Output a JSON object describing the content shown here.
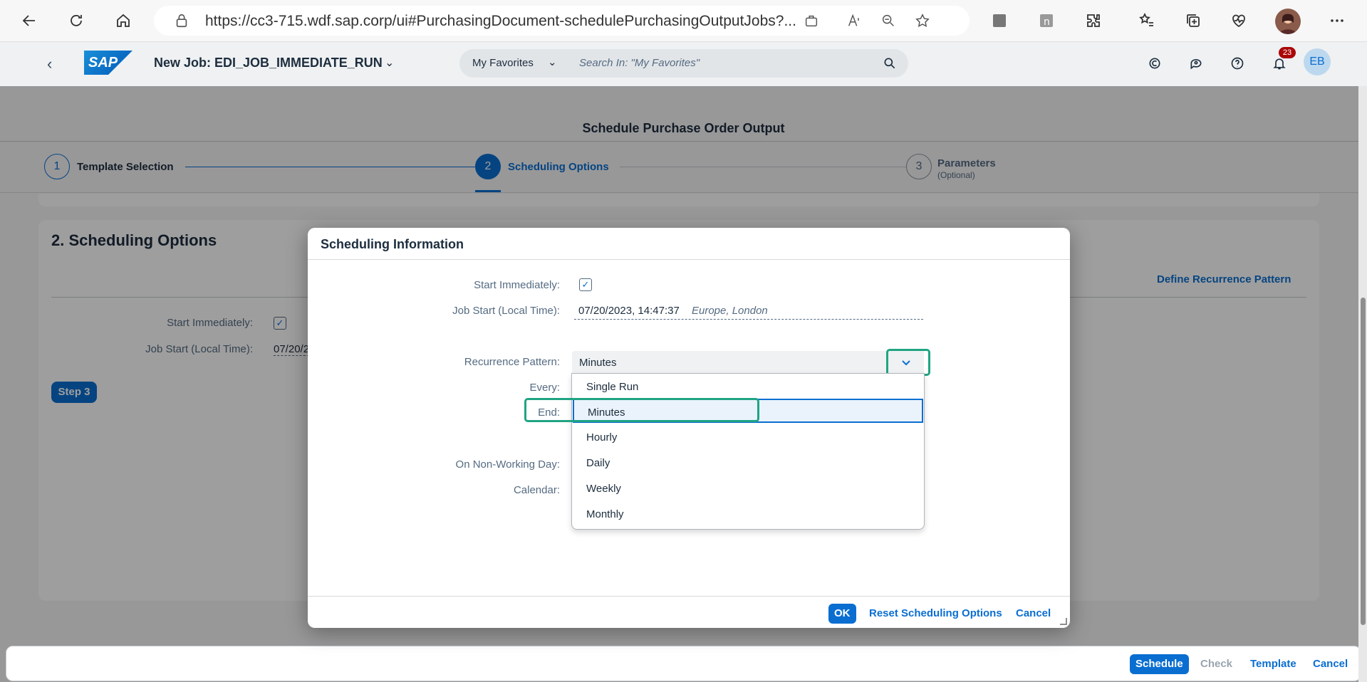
{
  "browser": {
    "url": "https://cc3-715.wdf.sap.corp/ui#PurchasingDocument-schedulePurchasingOutputJobs?..."
  },
  "shell": {
    "title": "New Job: EDI_JOB_IMMEDIATE_RUN",
    "search_scope": "My Favorites",
    "search_placeholder": "Search In: \"My Favorites\"",
    "notification_count": "23",
    "user_initials": "EB",
    "logo": "SAP"
  },
  "page": {
    "title": "Schedule Purchase Order Output",
    "steps": [
      {
        "number": "1",
        "label": "Template Selection"
      },
      {
        "number": "2",
        "label": "Scheduling Options"
      },
      {
        "number": "3",
        "label": "Parameters",
        "sublabel": "(Optional)"
      }
    ]
  },
  "background": {
    "section_title": "2. Scheduling Options",
    "define_recurrence_link": "Define Recurrence Pattern",
    "start_immediately_label": "Start Immediately:",
    "job_start_label": "Job Start (Local Time):",
    "job_start_value": "07/20/2",
    "step3_button": "Step 3"
  },
  "dialog": {
    "title": "Scheduling Information",
    "start_immediately_label": "Start Immediately:",
    "start_immediately_checked": true,
    "job_start_label": "Job Start (Local Time):",
    "job_start_value": "07/20/2023, 14:47:37",
    "timezone": "Europe, London",
    "recurrence_label": "Recurrence Pattern:",
    "recurrence_value": "Minutes",
    "every_label": "Every:",
    "end_label": "End:",
    "non_working_day_label": "On Non-Working Day:",
    "calendar_label": "Calendar:",
    "options": [
      "Single Run",
      "Minutes",
      "Hourly",
      "Daily",
      "Weekly",
      "Monthly"
    ],
    "ok_button": "OK",
    "reset_button": "Reset Scheduling Options",
    "cancel_button": "Cancel"
  },
  "footer": {
    "schedule": "Schedule",
    "check": "Check",
    "template": "Template",
    "cancel": "Cancel"
  },
  "colors": {
    "accent": "#0a6ed1",
    "highlight": "#20a483"
  }
}
